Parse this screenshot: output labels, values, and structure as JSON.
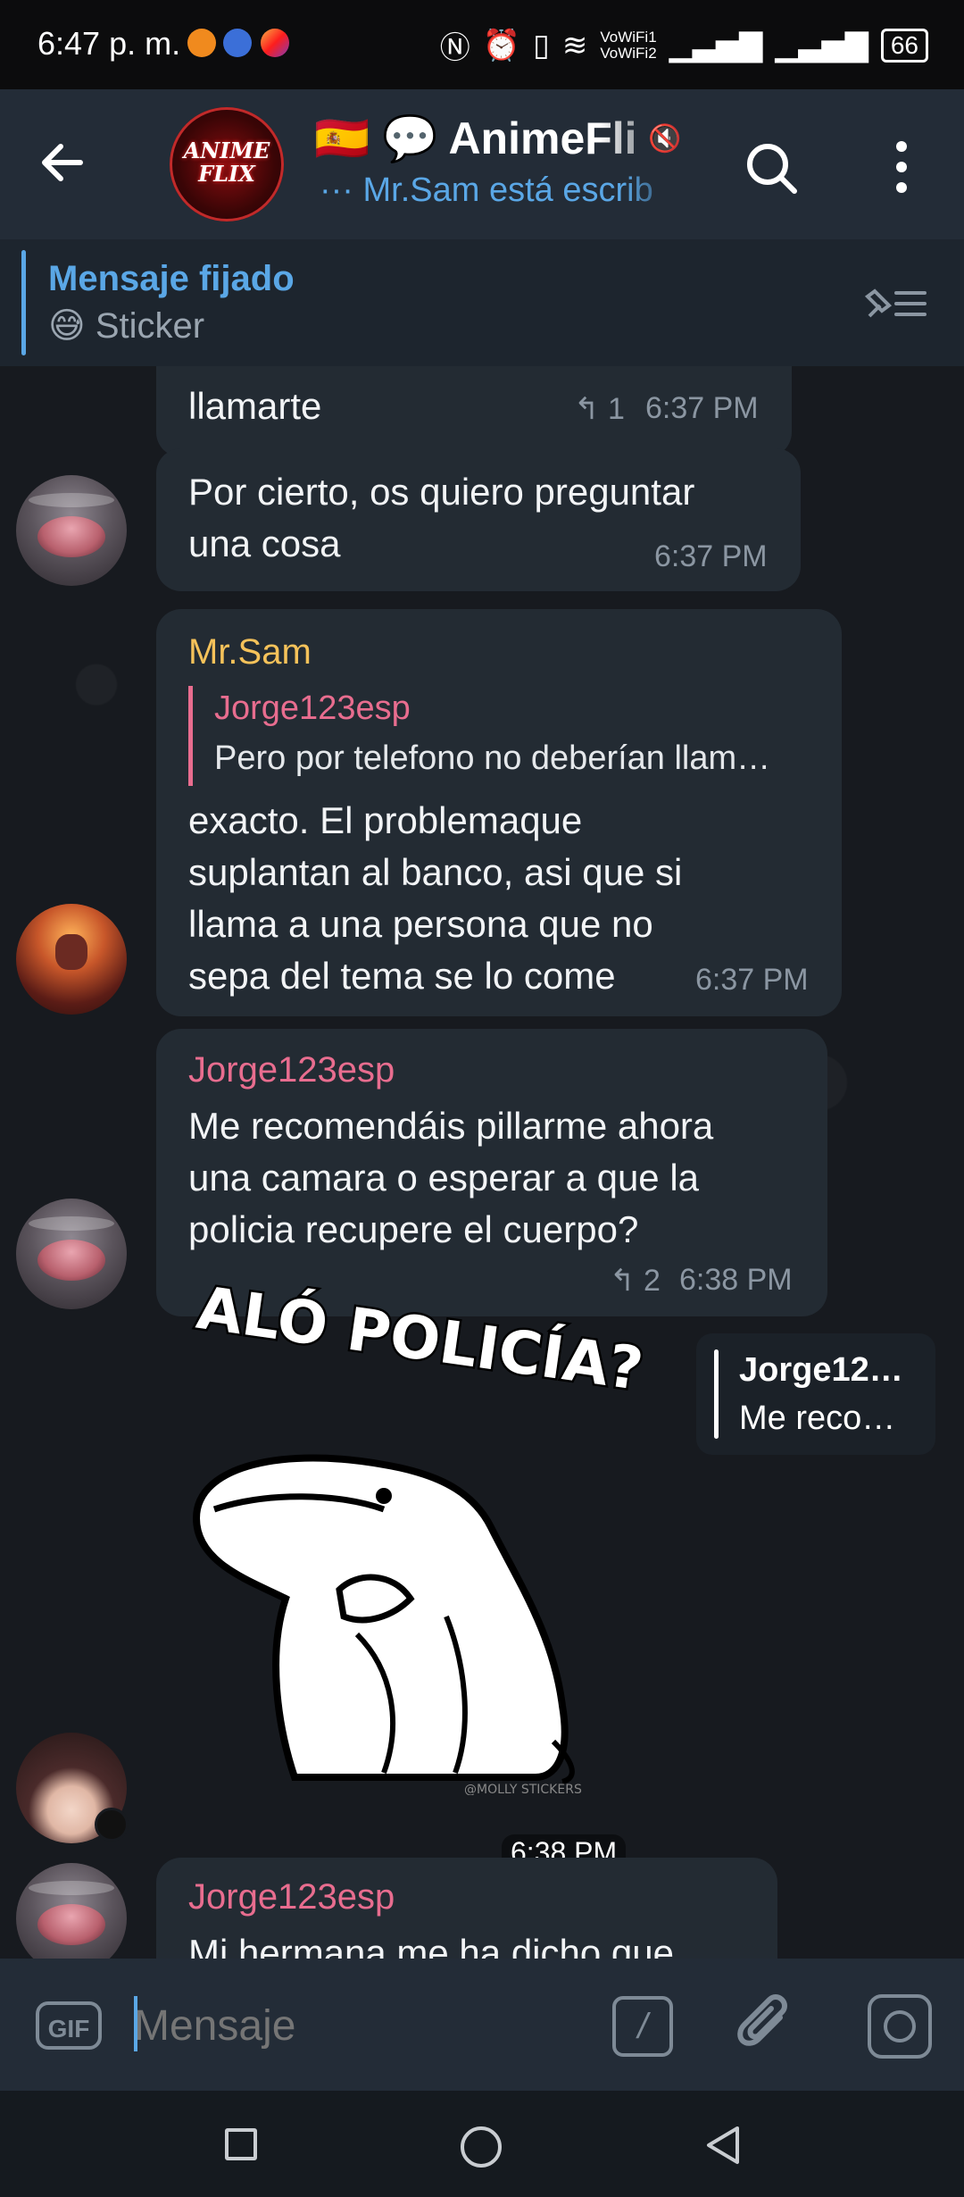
{
  "status_bar": {
    "time": "6:47 p. m.",
    "wifi_line1": "VoWiFi1",
    "wifi_line2": "VoWiFi2",
    "battery": "66"
  },
  "header": {
    "avatar_text": "ANIME FLIX",
    "title": "🇪🇸 💬 AnimeFli",
    "status": "··· Mr.Sam está escrib",
    "icons": [
      "back-arrow-icon",
      "mute-icon",
      "search-icon",
      "more-vert-icon"
    ]
  },
  "pinned": {
    "title": "Mensaje fijado",
    "text": "😅 Sticker"
  },
  "messages": [
    {
      "text": "llamarte",
      "reply_count": "1",
      "time": "6:37 PM"
    },
    {
      "text_line1": "Por cierto, os quiero preguntar",
      "text_line2": "una cosa",
      "time": "6:37 PM"
    },
    {
      "sender": "Mr.Sam",
      "quote_name": "Jorge123esp",
      "quote_text": "Pero por telefono no deberían llam…",
      "line1": "exacto. El problemaque",
      "line2": "suplantan al banco, asi que si",
      "line3": "llama a una persona que no",
      "line4": "sepa del tema se lo come",
      "time": "6:37 PM"
    },
    {
      "sender": "Jorge123esp",
      "line1": "Me recomendáis pillarme ahora",
      "line2": "una camara o esperar a que la",
      "line3": "policia recupere el cuerpo?",
      "reply_count": "2",
      "time": "6:38 PM"
    },
    {
      "sticker_text": "ALÓ POLICÍA?",
      "sticker_credit": "@MOLLY STICKERS",
      "time": "6:38 PM",
      "reply_name": "Jorge12…",
      "reply_text": "Me reco…"
    },
    {
      "sender": "Jorge123esp",
      "text": "Mi hermana me ha dicho que"
    }
  ],
  "input": {
    "gif_label": "GIF",
    "placeholder": "Mensaje",
    "commands_label": "/"
  },
  "colors": {
    "accent": "#5aa7e6",
    "sender_mrsam": "#f5c25a",
    "sender_jorge": "#e86d8f"
  }
}
